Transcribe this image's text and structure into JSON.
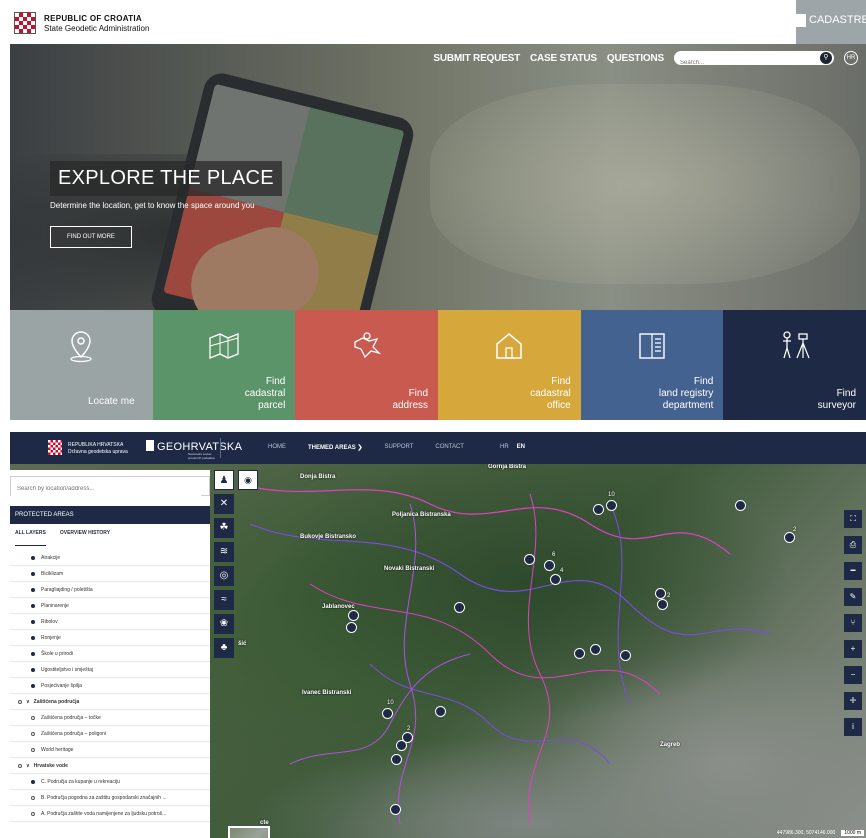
{
  "top": {
    "brand_line1": "REPUBLIC OF CROATIA",
    "brand_line2": "State Geodetic Administration",
    "cadastre_logo": "CADASTRE",
    "nav": [
      "SUBMIT REQUEST",
      "CASE STATUS",
      "QUESTIONS"
    ],
    "search_placeholder": "Search...",
    "lang_badge": "HR",
    "hero_title": "EXPLORE THE PLACE",
    "hero_subtitle": "Determine the location, get to know the space around you",
    "hero_button": "FIND OUT MORE",
    "tiles": [
      {
        "label": "Locate me",
        "color": "#9aa4a4",
        "icon": "location-pin-icon"
      },
      {
        "label": "Find\ncadastral\nparcel",
        "color": "#5b9468",
        "icon": "parcel-map-icon"
      },
      {
        "label": "Find\naddress",
        "color": "#c85a4f",
        "icon": "croatia-map-pin-icon"
      },
      {
        "label": "Find\ncadastral\noffice",
        "color": "#d6a83b",
        "icon": "house-icon"
      },
      {
        "label": "Find\nland registry\ndepartment",
        "color": "#44628f",
        "icon": "ledger-icon"
      },
      {
        "label": "Find\nsurveyor",
        "color": "#1e2a45",
        "icon": "surveyor-icon"
      }
    ]
  },
  "bottom": {
    "brand_line1": "REPUBLIKA HRVATSKA",
    "brand_line2": "Državna geodetska uprava",
    "logo": "GEOHRVATSKA",
    "logo_sub": "Nacionalni sustav prostornih podataka",
    "nav": [
      "HOME",
      "THEMED AREAS ❯",
      "SUPPORT",
      "CONTACT"
    ],
    "lang": [
      "HR",
      "EN"
    ],
    "search_placeholder": "Search by location/address...",
    "panel_title": "PROTECTED AREAS",
    "tabs": [
      "ALL LAYERS",
      "OVERVIEW HISTORY"
    ],
    "layers": [
      {
        "label": "Atrakcije",
        "kind": "dot"
      },
      {
        "label": "Biciklizam",
        "kind": "dot"
      },
      {
        "label": "Paragliajding / poletišta",
        "kind": "dot"
      },
      {
        "label": "Planinarenje",
        "kind": "dot"
      },
      {
        "label": "Ribolov",
        "kind": "dot"
      },
      {
        "label": "Ronjenje",
        "kind": "dot"
      },
      {
        "label": "Škole u prirodi",
        "kind": "dot"
      },
      {
        "label": "Ugostiteljstvo i smještaj",
        "kind": "dot"
      },
      {
        "label": "Posjećivanje špilja",
        "kind": "dot"
      },
      {
        "label": "Zaštićena područja",
        "kind": "group"
      },
      {
        "label": "Zaštićena područja – točke",
        "kind": "ring"
      },
      {
        "label": "Zaštićena područja – poligoni",
        "kind": "ring"
      },
      {
        "label": "World heritage",
        "kind": "ring"
      },
      {
        "label": "Hrvatske vode",
        "kind": "group"
      },
      {
        "label": "C. Područja za kupanje u rekreaciju",
        "kind": "dot"
      },
      {
        "label": "B. Područja pogodna za zaštitu gospodarski značajnih ...",
        "kind": "ring"
      },
      {
        "label": "A. Područja zaštite voda namijenjene za ljudsku potroš...",
        "kind": "ring"
      }
    ],
    "places": [
      {
        "label": "Donja Bistra"
      },
      {
        "label": "Gornja Bistra"
      },
      {
        "label": "Poljanica Bistranska"
      },
      {
        "label": "Bukovje Bistransko"
      },
      {
        "label": "Novaki Bistranski"
      },
      {
        "label": "Jablanovec"
      },
      {
        "label": "Ivanec Bistranski"
      },
      {
        "label": "Zagreb"
      },
      {
        "label": "šić"
      },
      {
        "label": "cte"
      }
    ],
    "cluster_counts": [
      "10",
      "6",
      "4",
      "2",
      "2",
      "10",
      "2"
    ],
    "scale_coords": "447986.300, 5074146.000",
    "scale_label": "1000 m"
  }
}
